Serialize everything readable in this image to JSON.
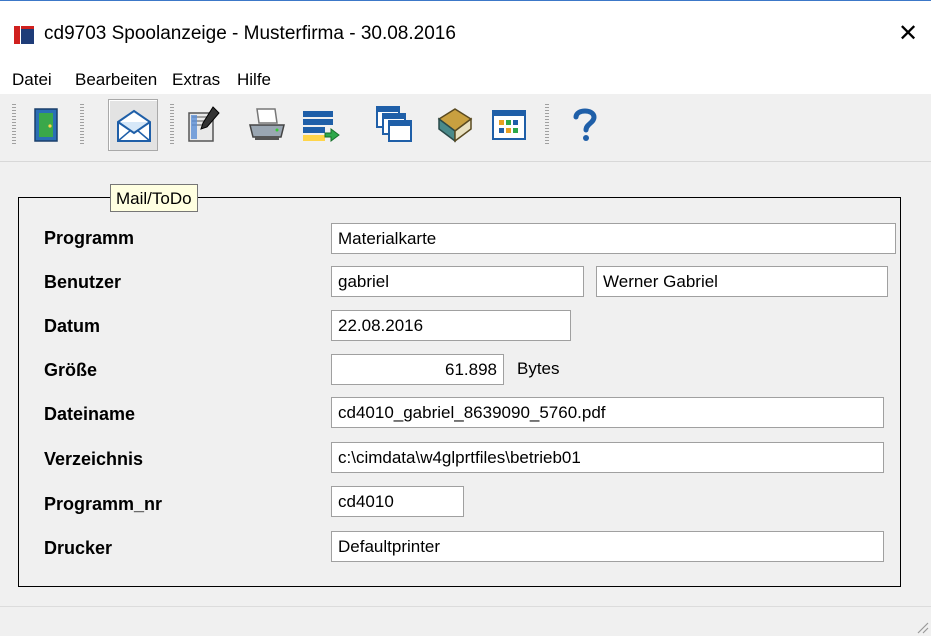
{
  "window": {
    "title": "cd9703 Spoolanzeige - Musterfirma - 30.08.2016",
    "close_glyph": "✕"
  },
  "menu": [
    "Datei",
    "Bearbeiten",
    "Extras",
    "Hilfe"
  ],
  "toolbar": {
    "buttons": [
      {
        "icon": "exit-door-icon"
      },
      {
        "icon": "mail-envelope-icon",
        "active": true
      },
      {
        "icon": "edit-document-icon"
      },
      {
        "icon": "printer-icon"
      },
      {
        "icon": "export-list-icon"
      },
      {
        "icon": "windows-cascade-icon"
      },
      {
        "icon": "book-icon"
      },
      {
        "icon": "calendar-grid-icon"
      },
      {
        "icon": "help-question-icon"
      }
    ],
    "tooltip": "Mail/ToDo"
  },
  "form": {
    "programm_label": "Programm",
    "programm_value": "Materialkarte",
    "benutzer_label": "Benutzer",
    "benutzer_value": "gabriel",
    "benutzer_name": "Werner Gabriel",
    "datum_label": "Datum",
    "datum_value": "22.08.2016",
    "groesse_label": "Größe",
    "groesse_value": "61.898",
    "groesse_unit": "Bytes",
    "dateiname_label": "Dateiname",
    "dateiname_value": "cd4010_gabriel_8639090_5760.pdf",
    "verzeichnis_label": "Verzeichnis",
    "verzeichnis_value": "c:\\cimdata\\w4glprtfiles\\betrieb01",
    "programm_nr_label": "Programm_nr",
    "programm_nr_value": "cd4010",
    "drucker_label": "Drucker",
    "drucker_value": "Defaultprinter"
  },
  "colors": {
    "titlebar_accent": "#3c78c8",
    "panel_bg": "#f0f0f0",
    "app_icon_red": "#d0201e",
    "app_icon_blue": "#1e3c78"
  }
}
